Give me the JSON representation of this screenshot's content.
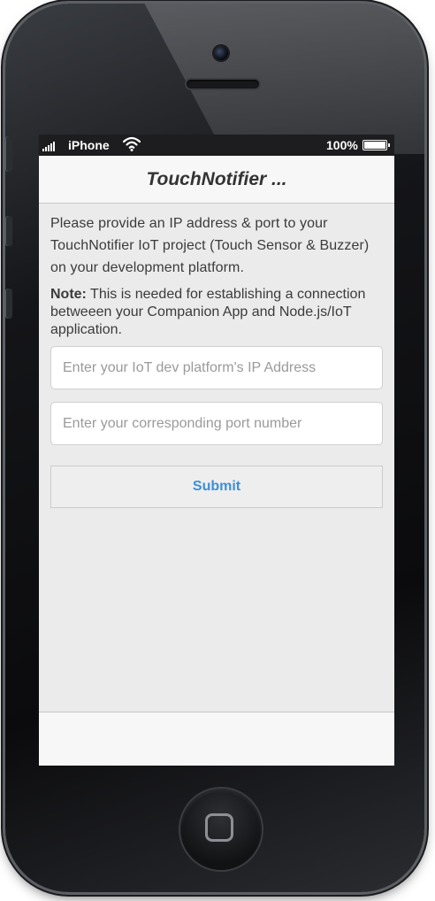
{
  "status_bar": {
    "carrier": "iPhone",
    "battery_percent": "100%",
    "battery_level": 1.0,
    "signal_icon": "signal-bars-icon",
    "wifi_icon": "wifi-icon",
    "battery_icon": "battery-icon"
  },
  "header": {
    "title": "TouchNotifier ..."
  },
  "content": {
    "intro": "Please provide an IP address & port to your TouchNotifier IoT project (Touch Sensor & Buzzer) on your development platform.",
    "note_label": "Note:",
    "note_text": " This is needed for establishing a connection betweeen your Companion App and Node.js/IoT application."
  },
  "form": {
    "ip_placeholder": "Enter your IoT dev platform's IP Address",
    "ip_value": "",
    "port_placeholder": "Enter your corresponding port number",
    "port_value": "",
    "submit_label": "Submit"
  },
  "colors": {
    "accent": "#3d8fd9",
    "screen_background": "#ebebeb",
    "header_background": "#f7f7f7",
    "status_bar_background": "#1d1d1f"
  }
}
